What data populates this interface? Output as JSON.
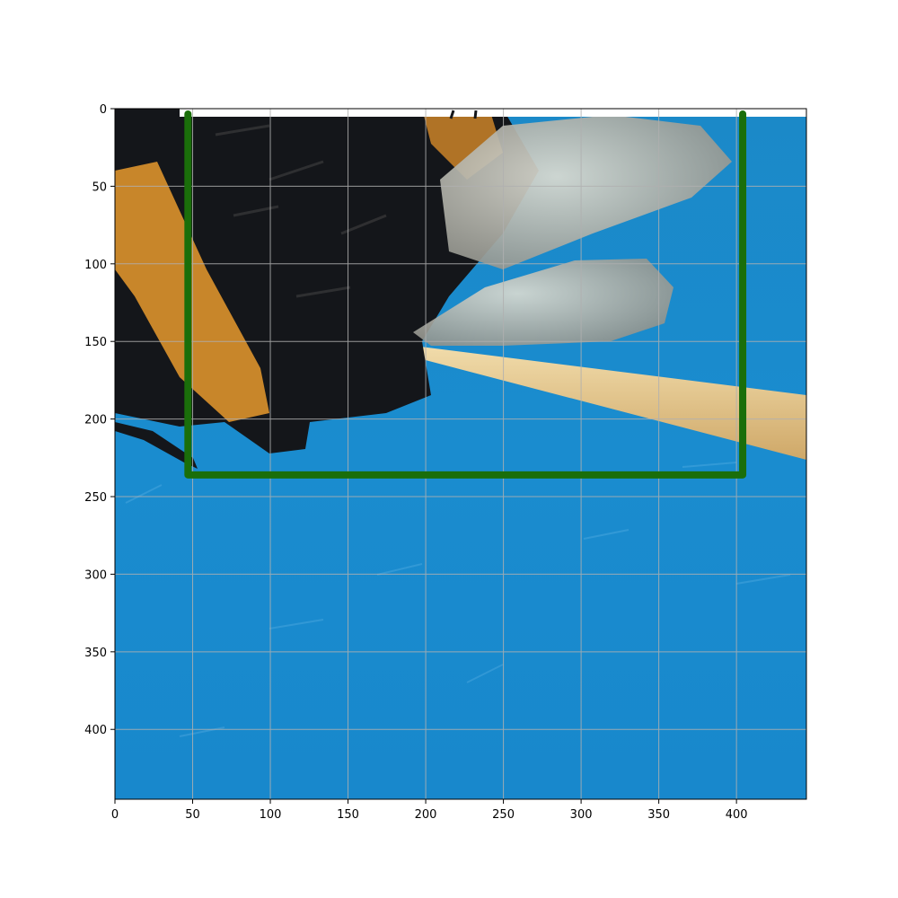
{
  "figure": {
    "description_kind": "photo-with-axes",
    "photo_subject": "bumblebee-on-wooden-stick-over-blue-surface"
  },
  "axes": {
    "x_ticks": [
      "0",
      "50",
      "100",
      "150",
      "200",
      "250",
      "300",
      "350",
      "400"
    ],
    "y_ticks": [
      "0",
      "50",
      "100",
      "150",
      "200",
      "250",
      "300",
      "350",
      "400"
    ],
    "x_values": [
      0,
      50,
      100,
      150,
      200,
      250,
      300,
      350,
      400
    ],
    "y_values": [
      0,
      50,
      100,
      150,
      200,
      250,
      300,
      350,
      400
    ],
    "xlim": [
      0,
      445
    ],
    "ylim": [
      445,
      0
    ],
    "y_inverted": true,
    "grid": true
  },
  "bounding_box": {
    "x_min": 47,
    "x_max": 404,
    "y_min": 0,
    "y_max": 236,
    "color": "#1a6e0a",
    "clipped_at_top": true
  },
  "colors": {
    "background_blue": "#1a8ccf",
    "grid": "#b0b0b0",
    "stick": "#e8c98a",
    "bee_black": "#14161a",
    "bee_orange": "#c8862a",
    "wing": "#b9b9b0"
  }
}
